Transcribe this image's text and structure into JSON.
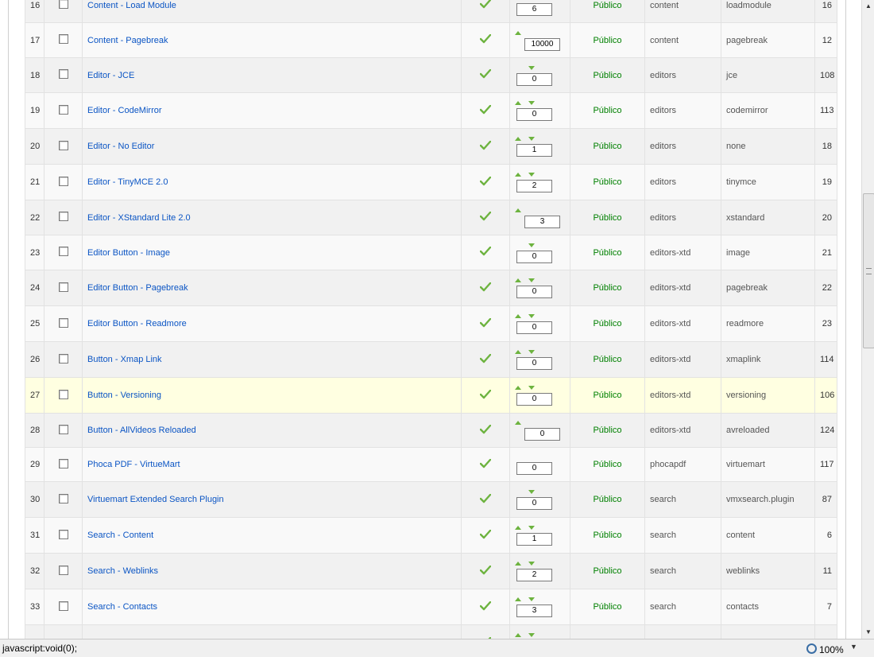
{
  "table": {
    "rows": [
      {
        "num": "16",
        "name": "Content - Load Module",
        "up": true,
        "down": true,
        "order": "6",
        "access": "Público",
        "type": "content",
        "element": "loadmodule",
        "id": "16"
      },
      {
        "num": "17",
        "name": "Content - Pagebreak",
        "up": true,
        "down": false,
        "order": "10000",
        "access": "Público",
        "type": "content",
        "element": "pagebreak",
        "id": "12"
      },
      {
        "num": "18",
        "name": "Editor - JCE",
        "up": false,
        "down": true,
        "order": "0",
        "access": "Público",
        "type": "editors",
        "element": "jce",
        "id": "108"
      },
      {
        "num": "19",
        "name": "Editor - CodeMirror",
        "up": true,
        "down": true,
        "order": "0",
        "access": "Público",
        "type": "editors",
        "element": "codemirror",
        "id": "113"
      },
      {
        "num": "20",
        "name": "Editor - No Editor",
        "up": true,
        "down": true,
        "order": "1",
        "access": "Público",
        "type": "editors",
        "element": "none",
        "id": "18"
      },
      {
        "num": "21",
        "name": "Editor - TinyMCE 2.0",
        "up": true,
        "down": true,
        "order": "2",
        "access": "Público",
        "type": "editors",
        "element": "tinymce",
        "id": "19"
      },
      {
        "num": "22",
        "name": "Editor - XStandard Lite 2.0",
        "up": true,
        "down": false,
        "order": "3",
        "access": "Público",
        "type": "editors",
        "element": "xstandard",
        "id": "20"
      },
      {
        "num": "23",
        "name": "Editor Button - Image",
        "up": false,
        "down": true,
        "order": "0",
        "access": "Público",
        "type": "editors-xtd",
        "element": "image",
        "id": "21"
      },
      {
        "num": "24",
        "name": "Editor Button - Pagebreak",
        "up": true,
        "down": true,
        "order": "0",
        "access": "Público",
        "type": "editors-xtd",
        "element": "pagebreak",
        "id": "22"
      },
      {
        "num": "25",
        "name": "Editor Button - Readmore",
        "up": true,
        "down": true,
        "order": "0",
        "access": "Público",
        "type": "editors-xtd",
        "element": "readmore",
        "id": "23"
      },
      {
        "num": "26",
        "name": "Button - Xmap Link",
        "up": true,
        "down": true,
        "order": "0",
        "access": "Público",
        "type": "editors-xtd",
        "element": "xmaplink",
        "id": "114"
      },
      {
        "num": "27",
        "name": "Button - Versioning",
        "up": true,
        "down": true,
        "order": "0",
        "access": "Público",
        "type": "editors-xtd",
        "element": "versioning",
        "id": "106"
      },
      {
        "num": "28",
        "name": "Button - AllVideos Reloaded",
        "up": true,
        "down": false,
        "order": "0",
        "access": "Público",
        "type": "editors-xtd",
        "element": "avreloaded",
        "id": "124"
      },
      {
        "num": "29",
        "name": "Phoca PDF - VirtueMart",
        "up": false,
        "down": false,
        "order": "0",
        "access": "Público",
        "type": "phocapdf",
        "element": "virtuemart",
        "id": "117"
      },
      {
        "num": "30",
        "name": "Virtuemart Extended Search Plugin",
        "up": false,
        "down": true,
        "order": "0",
        "access": "Público",
        "type": "search",
        "element": "vmxsearch.plugin",
        "id": "87"
      },
      {
        "num": "31",
        "name": "Search - Content",
        "up": true,
        "down": true,
        "order": "1",
        "access": "Público",
        "type": "search",
        "element": "content",
        "id": "6"
      },
      {
        "num": "32",
        "name": "Search - Weblinks",
        "up": true,
        "down": true,
        "order": "2",
        "access": "Público",
        "type": "search",
        "element": "weblinks",
        "id": "11"
      },
      {
        "num": "33",
        "name": "Search - Contacts",
        "up": true,
        "down": true,
        "order": "3",
        "access": "Público",
        "type": "search",
        "element": "contacts",
        "id": "7"
      },
      {
        "num": "",
        "name": "",
        "up": true,
        "down": true,
        "order": "",
        "access": "",
        "type": "",
        "element": "",
        "id": ""
      }
    ]
  },
  "icons": {
    "published": "check-icon",
    "order_up": "arrow-up-icon",
    "order_down": "arrow-down-icon",
    "zoom": "magnifier-icon"
  },
  "colors": {
    "link": "#0b55c4",
    "access": "#008000",
    "check": "#6db33f",
    "highlight_row": "#ffffe1"
  },
  "statusbar": {
    "text": "javascript:void(0);",
    "zoom": "100%"
  }
}
